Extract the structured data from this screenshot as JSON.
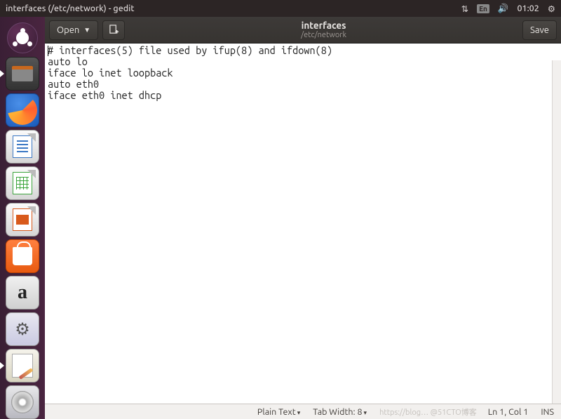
{
  "top_panel": {
    "window_title": "interfaces (/etc/network) - gedit",
    "lang_indicator": "En",
    "time": "01:02"
  },
  "launcher": {
    "items": [
      {
        "name": "ubuntu-dash",
        "active": false
      },
      {
        "name": "files",
        "active": true
      },
      {
        "name": "firefox",
        "active": false
      },
      {
        "name": "libre-writer",
        "active": false
      },
      {
        "name": "libre-calc",
        "active": false
      },
      {
        "name": "libre-impress",
        "active": false
      },
      {
        "name": "ubuntu-software",
        "active": false
      },
      {
        "name": "amazon",
        "active": false
      },
      {
        "name": "system-settings",
        "active": false
      },
      {
        "name": "gedit",
        "active": true
      },
      {
        "name": "trash",
        "active": false
      }
    ]
  },
  "header": {
    "open_label": "Open",
    "save_label": "Save",
    "doc_title": "interfaces",
    "doc_path": "/etc/network"
  },
  "editor": {
    "content": "# interfaces(5) file used by ifup(8) and ifdown(8)\nauto lo\niface lo inet loopback\nauto eth0\niface eth0 inet dhcp"
  },
  "status": {
    "syntax": "Plain Text",
    "tab_width": "Tab Width: 8",
    "cursor": "Ln 1, Col 1",
    "insert_mode": "INS",
    "watermark": "https://blog… @51CTO博客"
  }
}
